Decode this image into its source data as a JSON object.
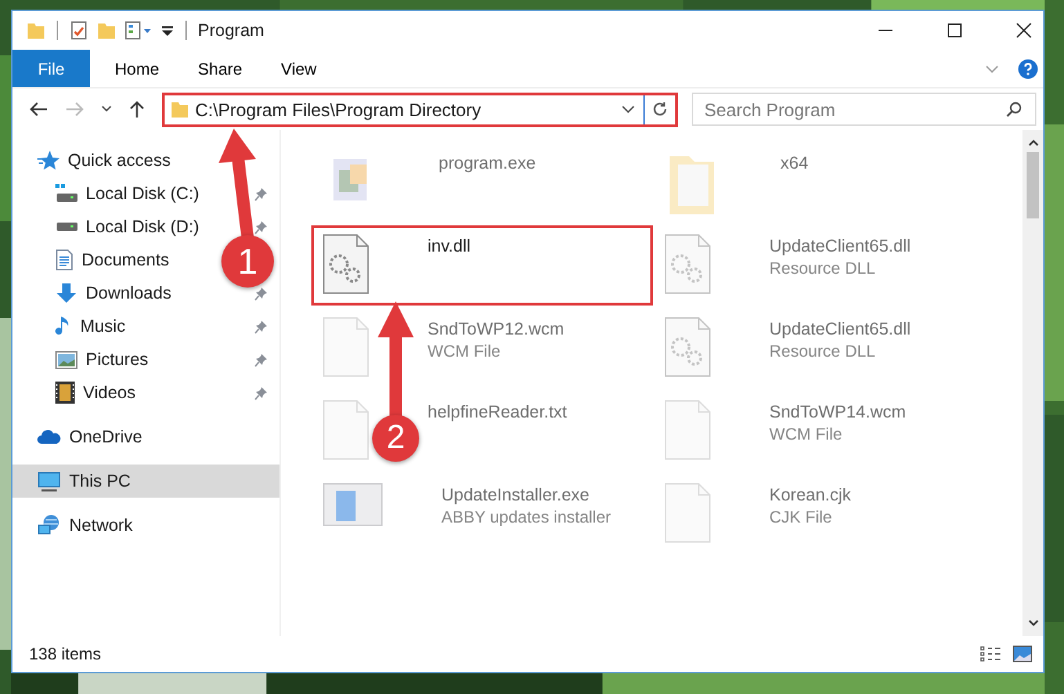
{
  "window": {
    "title": "Program"
  },
  "ribbon": {
    "tabs": [
      {
        "label": "File",
        "kind": "file"
      },
      {
        "label": "Home",
        "kind": "tab"
      },
      {
        "label": "Share",
        "kind": "tab"
      },
      {
        "label": "View",
        "kind": "tab"
      }
    ]
  },
  "address_bar": {
    "path": "C:\\Program Files\\Program Directory",
    "highlighted": true
  },
  "search": {
    "placeholder": "Search Program"
  },
  "navigation": [
    {
      "label": "Quick access",
      "selected": false,
      "children": [
        {
          "label": "Local Disk (C:)",
          "pinned": true,
          "selected": false
        },
        {
          "label": "Local Disk (D:)",
          "pinned": true,
          "selected": false
        },
        {
          "label": "Documents",
          "pinned": false,
          "selected": false
        },
        {
          "label": "Downloads",
          "pinned": true,
          "selected": false
        },
        {
          "label": "Music",
          "pinned": true,
          "selected": false
        },
        {
          "label": "Pictures",
          "pinned": true,
          "selected": false
        },
        {
          "label": "Videos",
          "pinned": true,
          "selected": false
        }
      ]
    },
    {
      "label": "OneDrive",
      "selected": false
    },
    {
      "label": "This PC",
      "selected": true
    },
    {
      "label": "Network",
      "selected": false
    }
  ],
  "files": [
    {
      "name": "program.exe",
      "kind": "exe",
      "blurred": true,
      "highlighted": false
    },
    {
      "name": "x64",
      "kind": "folder",
      "blurred": true,
      "highlighted": false
    },
    {
      "name": "inv.dll",
      "kind": "dll",
      "blurred": false,
      "highlighted": true
    },
    {
      "name": "UpdateClient65.dll",
      "detail": "Resource DLL",
      "kind": "dll",
      "blurred": true,
      "highlighted": false
    },
    {
      "name": "SndToWP12.wcm",
      "detail": "WCM File",
      "kind": "file",
      "blurred": true,
      "highlighted": false
    },
    {
      "name": "UpdateClient65.dll",
      "detail": "Resource DLL",
      "kind": "dll",
      "blurred": true,
      "highlighted": false
    },
    {
      "name": "helpfineReader.txt",
      "kind": "file",
      "blurred": true,
      "highlighted": false
    },
    {
      "name": "SndToWP14.wcm",
      "detail": "WCM File",
      "kind": "file",
      "blurred": true,
      "highlighted": false
    },
    {
      "name": "UpdateInstaller.exe",
      "detail": "ABBY updates installer",
      "kind": "installer",
      "blurred": true,
      "highlighted": false
    },
    {
      "name": "Korean.cjk",
      "detail": "CJK File",
      "kind": "file",
      "blurred": true,
      "highlighted": false
    }
  ],
  "annotations": [
    {
      "number": "1"
    },
    {
      "number": "2"
    }
  ],
  "status_bar": {
    "item_count": "138 items"
  }
}
